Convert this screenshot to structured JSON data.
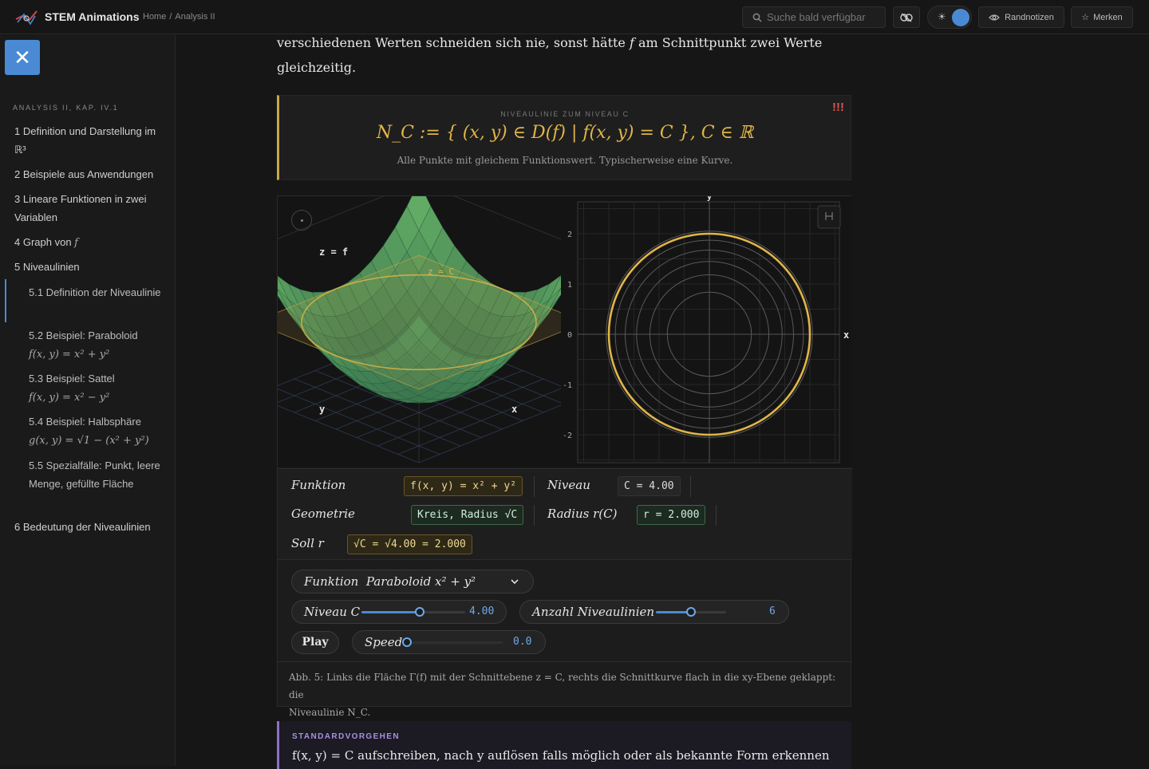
{
  "topbar": {
    "brand": "STEM Animations",
    "crumb_home": "Home",
    "crumb_sep": "/",
    "crumb_current": "Analysis II",
    "search_placeholder": "Suche bald verfügbar",
    "theme_icon": "☀",
    "notes_label": "Randnotizen",
    "bookmark_label": "Merken",
    "accent_color": "#4a8ad4"
  },
  "close_label": "✕",
  "sidebar": {
    "heading": "ANALYSIS II, KAP. IV.1",
    "items": [
      {
        "label": "1 Definition und Darstellung im ℝ³"
      },
      {
        "label": "2 Beispiele aus Anwendungen"
      },
      {
        "label": "3 Lineare Funktionen in zwei Variablen"
      },
      {
        "label": "4 Graph von",
        "math": "f"
      },
      {
        "label": "5 Niveaulinien"
      },
      {
        "label": "5.1 Definition der Niveaulinie"
      },
      {
        "label": "5.2 Beispiel: Paraboloid",
        "math": "f(x, y) = x² + y²"
      },
      {
        "label": "5.3 Beispiel: Sattel",
        "math": "f(x, y) = x² − y²"
      },
      {
        "label": "5.4 Beispiel: Halbsphäre",
        "math": "g(x, y) = √1 − (x² + y²)"
      },
      {
        "label": "5.5 Spezialfälle: Punkt, leere Menge, gefüllte Fläche"
      },
      {
        "label": "6 Bedeutung der Niveaulinien"
      }
    ]
  },
  "content": {
    "para_line1_a": "verschiedenen Werten schneiden sich nie, sonst hätte ",
    "para_f": "f",
    "para_line1_b": " am Schnittpunkt zwei Werte",
    "para_line2": "gleichzeitig.",
    "def_label": "NIVEAULINIE ZUM NIVEAU C",
    "def_formula": "N_C := { (x, y) ∈ D(f) | f(x, y) = C },   C ∈ ℝ",
    "def_desc": "Alle Punkte mit gleichem Funktionswert. Typischerweise eine Kurve.",
    "def_mark": "!!!"
  },
  "plot3d": {
    "label_z": "z = f",
    "label_plane": "z = C",
    "label_x": "x",
    "label_y": "y"
  },
  "plot2d": {
    "ticks_y": [
      "2",
      "1",
      "0",
      "-1",
      "-2"
    ],
    "label_x": "x",
    "label_y": "y",
    "level_radius": 2.0,
    "contour_count": 6
  },
  "readouts": {
    "funktion_label": "Funktion",
    "funktion_value": "f(x, y) = x² + y²",
    "niveau_label": "Niveau",
    "niveau_value": "C = 4.00",
    "geometrie_label": "Geometrie",
    "geometrie_value": "Kreis, Radius √C",
    "radius_label": "Radius r(C)",
    "radius_value": "r = 2.000",
    "soll_label": "Soll r",
    "soll_value": "√C = √4.00 = 2.000"
  },
  "controls": {
    "funktion_label": "Funktion",
    "funktion_selected": "Paraboloid x² + y²",
    "niveau_label": "Niveau C",
    "niveau_value": "4.00",
    "niveau_fraction": 0.56,
    "anzahl_label": "Anzahl Niveaulinien",
    "anzahl_value": "6",
    "anzahl_fraction": 0.5,
    "play_label": "Play",
    "speed_label": "Speed",
    "speed_value": "0.0",
    "speed_fraction": 0.0
  },
  "caption": {
    "line1": "Abb. 5: Links die Fläche Γ(f) mit der Schnittebene z = C, rechts die Schnittkurve flach in die xy-Ebene geklappt: die",
    "line2": "Niveaulinie N_C."
  },
  "standard": {
    "label": "STANDARDVORGEHEN",
    "text": "f(x, y) = C aufschreiben, nach y auflösen falls möglich oder als bekannte Form erkennen"
  }
}
